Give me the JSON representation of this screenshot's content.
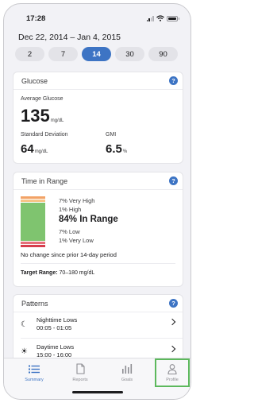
{
  "status_bar": {
    "time": "17:28"
  },
  "date_range": "Dec 22, 2014 – Jan 4, 2015",
  "periods": [
    "2",
    "7",
    "14",
    "30",
    "90"
  ],
  "active_period": "14",
  "glucose": {
    "title": "Glucose",
    "average_label": "Average Glucose",
    "average_value": "135",
    "average_unit": "mg/dL",
    "sd_label": "Standard Deviation",
    "sd_value": "64",
    "sd_unit": "mg/dL",
    "gmi_label": "GMI",
    "gmi_value": "6.5",
    "gmi_unit": "%"
  },
  "time_in_range": {
    "title": "Time in Range",
    "very_high": "7% Very High",
    "high": "1% High",
    "in_range": "84% In Range",
    "low": "7% Low",
    "very_low": "1% Very Low",
    "note": "No change since prior 14-day period",
    "target_label": "Target Range:",
    "target_value": "70–180 mg/dL",
    "colors": {
      "very_high": "#f2a265",
      "high": "#f7c486",
      "in_range": "#7fc46f",
      "low": "#e56f79",
      "very_low": "#d63d4d"
    }
  },
  "patterns": {
    "title": "Patterns",
    "items": [
      {
        "icon": "moon-icon",
        "title": "Nighttime Lows",
        "time": "00:05 - 01:05"
      },
      {
        "icon": "sun-icon",
        "title": "Daytime Lows",
        "time": "15:00 - 16:00"
      }
    ]
  },
  "help_icon_label": "?",
  "tabs": [
    {
      "label": "Summary",
      "icon": "list-icon",
      "active": true
    },
    {
      "label": "Reports",
      "icon": "document-icon",
      "active": false
    },
    {
      "label": "Goals",
      "icon": "bar-chart-icon",
      "active": false
    },
    {
      "label": "Profile",
      "icon": "person-icon",
      "active": false
    }
  ],
  "accent_color": "#3d74c4"
}
